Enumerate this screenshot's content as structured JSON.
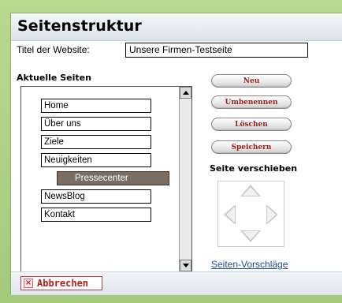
{
  "header": {
    "title": "Seitenstruktur"
  },
  "site_title": {
    "label": "Titel der Website:",
    "value": "Unsere Firmen-Testseite"
  },
  "pages_section": {
    "heading": "Aktuelle Seiten",
    "items": [
      {
        "label": "Home",
        "level": 0,
        "selected": false
      },
      {
        "label": "Über uns",
        "level": 0,
        "selected": false
      },
      {
        "label": "Ziele",
        "level": 0,
        "selected": false
      },
      {
        "label": "Neuigkeiten",
        "level": 0,
        "selected": false
      },
      {
        "label": "Pressecenter",
        "level": 1,
        "selected": true
      },
      {
        "label": "NewsBlog",
        "level": 0,
        "selected": false
      },
      {
        "label": "Kontakt",
        "level": 0,
        "selected": false
      }
    ]
  },
  "actions": {
    "new_label": "Neu",
    "rename_label": "Umbenennen",
    "delete_label": "Löschen",
    "save_label": "Speichern"
  },
  "move": {
    "heading": "Seite verschieben",
    "icons": [
      "arrow-up-icon",
      "arrow-down-icon",
      "arrow-left-icon",
      "arrow-right-icon"
    ]
  },
  "suggestions_link": "Seiten-Vorschläge",
  "footer": {
    "cancel_label": "Abbrechen",
    "cancel_icon": "close-icon"
  },
  "colors": {
    "frame_green": "#a5c97a",
    "selected_item": "#7a6d64",
    "button_text": "#9a1f1f",
    "link": "#1b4f8a"
  }
}
